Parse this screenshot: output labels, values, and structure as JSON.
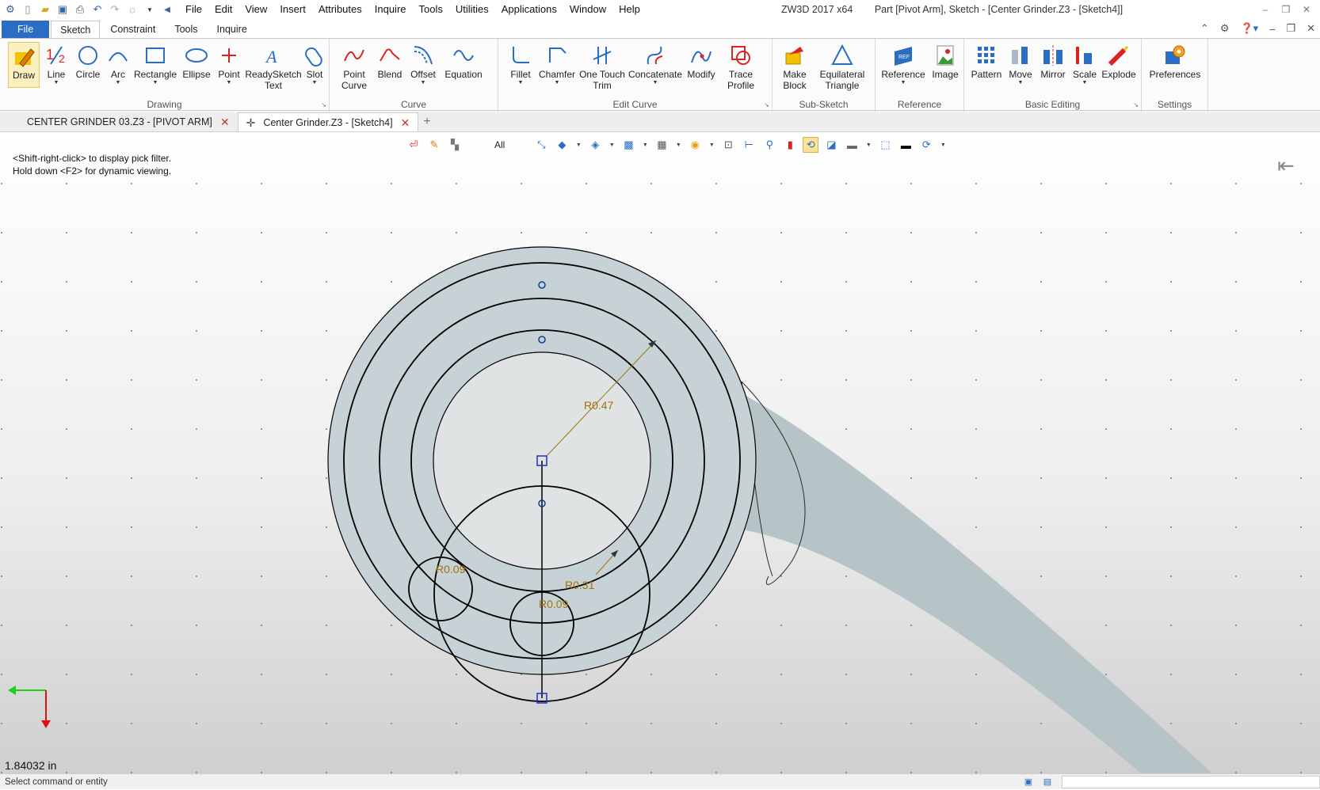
{
  "titlebar": {
    "menus": [
      "File",
      "Edit",
      "View",
      "Insert",
      "Attributes",
      "Inquire",
      "Tools",
      "Utilities",
      "Applications",
      "Window",
      "Help"
    ],
    "app_name": "ZW3D 2017  x64",
    "doc_title": "Part [Pivot Arm],  Sketch - [Center Grinder.Z3 - [Sketch4]]"
  },
  "ribbon_tabs": {
    "file": "File",
    "tabs": [
      "Sketch",
      "Constraint",
      "Tools",
      "Inquire"
    ]
  },
  "ribbon": {
    "drawing": {
      "label": "Drawing",
      "draw": "Draw",
      "line": "Line",
      "circle": "Circle",
      "arc": "Arc",
      "rectangle": "Rectangle",
      "ellipse": "Ellipse",
      "point": "Point",
      "readysketch_1": "ReadySketch",
      "readysketch_2": "Text",
      "slot": "Slot"
    },
    "curve": {
      "label": "Curve",
      "point_curve_1": "Point",
      "point_curve_2": "Curve",
      "blend": "Blend",
      "offset": "Offset",
      "equation": "Equation"
    },
    "edit_curve": {
      "label": "Edit Curve",
      "fillet": "Fillet",
      "chamfer": "Chamfer",
      "one_touch_1": "One Touch",
      "one_touch_2": "Trim",
      "concatenate": "Concatenate",
      "modify": "Modify",
      "trace_1": "Trace",
      "trace_2": "Profile"
    },
    "sub_sketch": {
      "label": "Sub-Sketch",
      "make_block_1": "Make",
      "make_block_2": "Block",
      "equilateral_1": "Equilateral",
      "equilateral_2": "Triangle"
    },
    "reference": {
      "label": "Reference",
      "reference": "Reference",
      "image": "Image"
    },
    "basic_editing": {
      "label": "Basic Editing",
      "pattern": "Pattern",
      "move": "Move",
      "mirror": "Mirror",
      "scale": "Scale",
      "explode": "Explode"
    },
    "settings": {
      "label": "Settings",
      "preferences": "Preferences"
    }
  },
  "doc_tabs": [
    {
      "label": "CENTER GRINDER 03.Z3 - [PIVOT ARM]",
      "active": false
    },
    {
      "label": "Center Grinder.Z3 - [Sketch4]",
      "active": true
    }
  ],
  "viewport": {
    "filter": "All",
    "hint_line1": "<Shift-right-click> to display pick filter.",
    "hint_line2": "Hold down <F2> for dynamic viewing.",
    "coordinate": "1.84032 in",
    "dimensions": {
      "outer_radius": "R0.47",
      "inner_radius": "R0.31",
      "small_left": "R0.09",
      "small_bottom": "R0.09"
    }
  },
  "status": {
    "message": "Select command or entity"
  },
  "colors": {
    "file_tab": "#2a6dc3",
    "sketch_fill": "#c6d2d6",
    "dimension": "#a0720c",
    "arm": "#b6c4c8"
  }
}
